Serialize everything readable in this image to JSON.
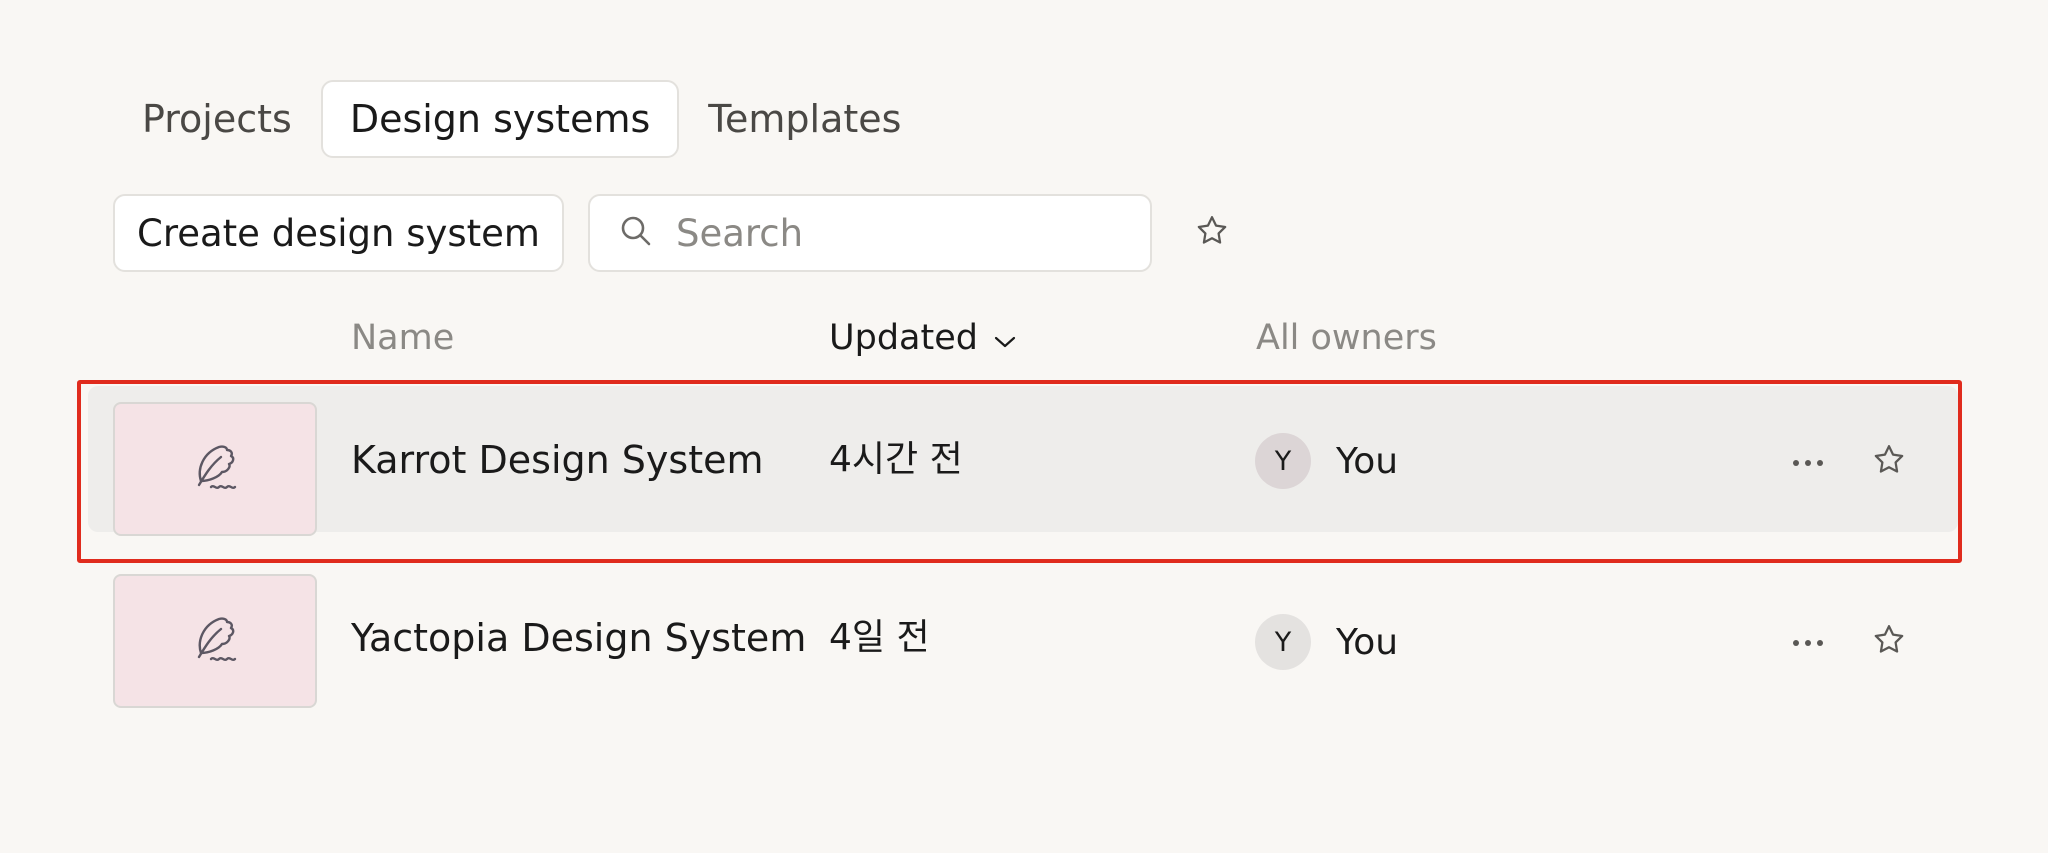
{
  "tabs": [
    {
      "label": "Projects",
      "active": false
    },
    {
      "label": "Design systems",
      "active": true
    },
    {
      "label": "Templates",
      "active": false
    }
  ],
  "toolbar": {
    "create_label": "Create design system",
    "search": {
      "placeholder": "Search",
      "value": ""
    },
    "star_icon": "star-outline-icon"
  },
  "table": {
    "columns": {
      "name": "Name",
      "updated": "Updated",
      "owners": "All owners"
    },
    "sort_icon": "chevron-down-icon",
    "rows": [
      {
        "name": "Karrot Design System",
        "updated": "4시간 전",
        "owner_initial": "Y",
        "owner_name": "You",
        "thumb_icon": "feather-icon",
        "selected": true
      },
      {
        "name": "Yactopia Design System",
        "updated": "4일 전",
        "owner_initial": "Y",
        "owner_name": "You",
        "thumb_icon": "feather-icon",
        "selected": false
      }
    ]
  },
  "colors": {
    "background": "#f9f7f4",
    "thumbnail": "#f5e3e6",
    "highlight": "#e02b1d",
    "selected_row": "#eeedeb"
  }
}
